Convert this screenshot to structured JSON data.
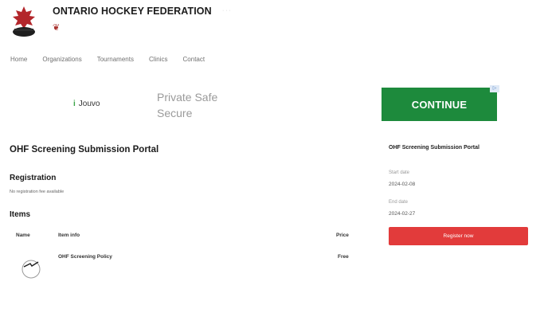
{
  "header": {
    "org_name": "ONTARIO HOCKEY FEDERATION",
    "extra": "· · ·"
  },
  "nav": {
    "items": [
      "Home",
      "Organizations",
      "Tournaments",
      "Clinics",
      "Contact"
    ]
  },
  "ad": {
    "brand": "Jouvo",
    "tagline": "Private  Safe Secure",
    "fine_print": "",
    "continue_label": "CONTINUE",
    "choice_label": "▷"
  },
  "main": {
    "title": "OHF Screening Submission Portal",
    "registration_heading": "Registration",
    "registration_note": "No registration fee available",
    "items_heading": "Items",
    "table_headers": {
      "name": "Name",
      "info": "Item info",
      "price": "Price"
    },
    "items": [
      {
        "title": "OHF Screening Policy",
        "price": "Free",
        "description": ""
      }
    ]
  },
  "sidebar": {
    "title": "OHF Screening Submission Portal",
    "start_label": "Start date",
    "start_value": "2024-02-08",
    "end_label": "End date",
    "end_value": "2024-02-27",
    "register_label": "Register now"
  },
  "colors": {
    "brand_red": "#a8322e",
    "continue_green": "#1d8a3c",
    "register_red": "#e23b3b"
  }
}
